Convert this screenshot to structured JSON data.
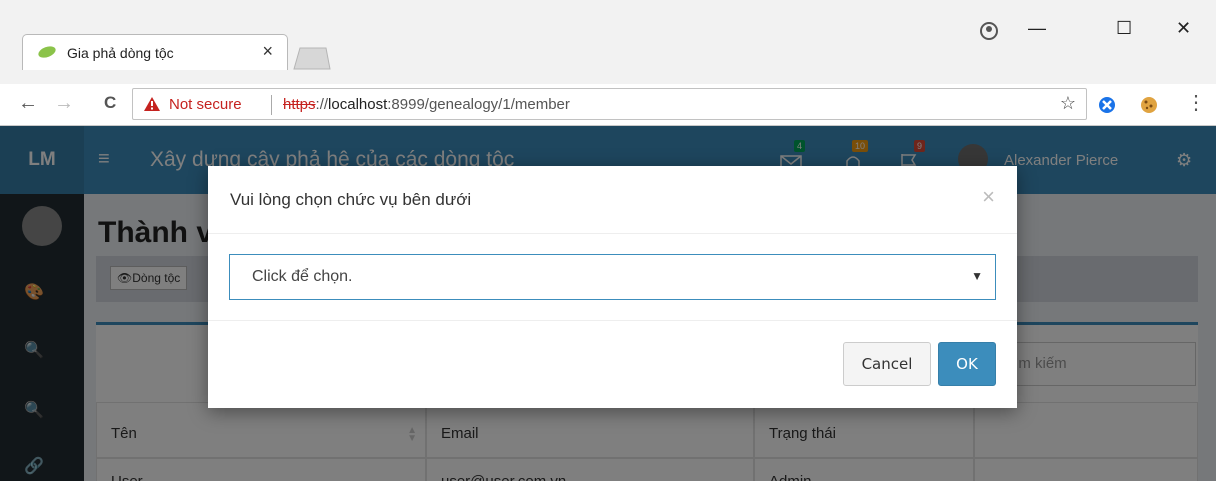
{
  "browser": {
    "tab_title": "Gia phả dòng tộc",
    "tab_close": "×",
    "minimize": "—",
    "maximize": "☐",
    "close": "✕",
    "back": "←",
    "forward": "→",
    "reload": "C",
    "not_secure": "Not secure",
    "url_scheme": "https",
    "url_sep": "://",
    "url_host": "localhost",
    "url_rest": ":8999/genealogy/1/member",
    "star": "☆",
    "menu": "⋮"
  },
  "app": {
    "logo": "LM",
    "menu_icon": "≡",
    "title": "Xây dựng cây phả hệ của các dòng tộc",
    "badges": {
      "messages": "4",
      "notifications": "10",
      "tasks": "9"
    },
    "user_name": "Alexander Pierce",
    "settings_icon": "⚙",
    "page_title": "Thành viên",
    "breadcrumb": "👁Dòng tộc",
    "search_placeholder": "Tìm kiếm",
    "table": {
      "columns": [
        "Tên",
        "Email",
        "Trạng thái",
        ""
      ],
      "rows": [
        [
          "User",
          "user@user.com.vn",
          "Admin",
          ""
        ]
      ]
    },
    "sidebar_icons": [
      "🎨",
      "🔍",
      "🔍",
      "🔗"
    ]
  },
  "modal": {
    "title": "Vui lòng chọn chức vụ bên dưới",
    "close": "×",
    "select_value": "Click để chọn.",
    "select_arrow": "▼",
    "cancel_label": "Cancel",
    "ok_label": "OK"
  },
  "colors": {
    "header": "#3c8dbc",
    "sidebar": "#222d32",
    "ok_button": "#3c8dbc",
    "not_secure": "#c5221f"
  }
}
